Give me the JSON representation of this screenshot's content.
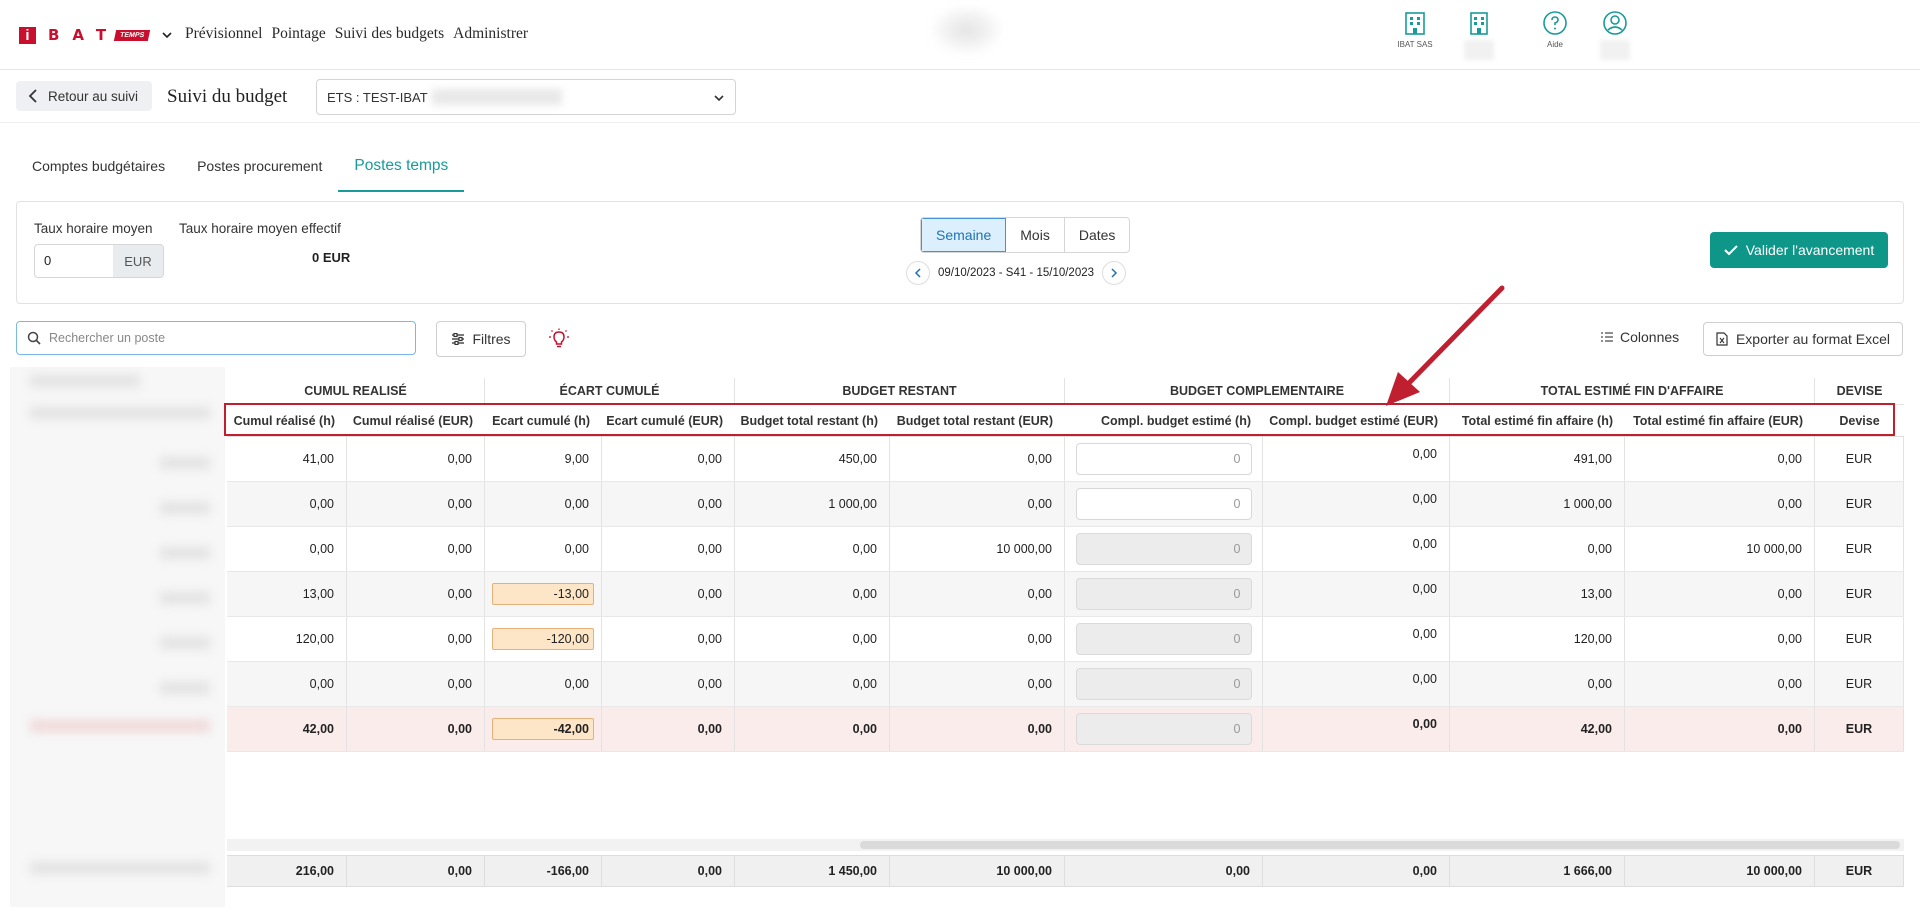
{
  "brand": {
    "letters": "BAT",
    "i": "i",
    "badge": "TEMPS"
  },
  "nav": [
    "Prévisionnel",
    "Pointage",
    "Suivi des budgets",
    "Administrer"
  ],
  "top_icons": [
    {
      "name": "building-icon",
      "label": "IBAT SAS"
    },
    {
      "name": "building-2-icon",
      "label": ""
    },
    {
      "name": "help-icon",
      "label": "Aide"
    },
    {
      "name": "user-icon",
      "label": ""
    }
  ],
  "subheader": {
    "back": "Retour au suivi",
    "title": "Suivi du budget",
    "ets": "ETS : TEST-IBAT"
  },
  "tabs": [
    "Comptes budgétaires",
    "Postes procurement",
    "Postes temps"
  ],
  "card": {
    "rate_label": "Taux horaire moyen",
    "rate_value": "0",
    "rate_unit": "EUR",
    "eff_label": "Taux horaire moyen effectif",
    "eff_value": "0 EUR",
    "periods": [
      "Semaine",
      "Mois",
      "Dates"
    ],
    "date_range": "09/10/2023 - S41 - 15/10/2023",
    "validate": "Valider l'avancement"
  },
  "toolbar": {
    "search_placeholder": "Rechercher un poste",
    "filters": "Filtres",
    "columns": "Colonnes",
    "export": "Exporter au format Excel"
  },
  "table": {
    "groups": [
      "CUMUL REALISÉ",
      "ÉCART CUMULÉ",
      "BUDGET RESTANT",
      "BUDGET COMPLEMENTAIRE",
      "TOTAL ESTIMÉ FIN D'AFFAIRE",
      "DEVISE"
    ],
    "headers": [
      "Cumul réalisé (h)",
      "Cumul réalisé (EUR)",
      "Ecart cumulé (h)",
      "Ecart cumulé (EUR)",
      "Budget total restant (h)",
      "Budget total restant (EUR)",
      "Compl. budget estimé (h)",
      "Compl. budget estimé (EUR)",
      "Total estimé fin affaire (h)",
      "Total estimé fin affaire (EUR)",
      "Devise"
    ],
    "rows": [
      {
        "c0": "41,00",
        "c1": "0,00",
        "c2": "9,00",
        "c3": "0,00",
        "c4": "450,00",
        "c5": "0,00",
        "c6": "0",
        "c7": "0,00",
        "c8": "491,00",
        "c9": "0,00",
        "c10": "EUR"
      },
      {
        "c0": "0,00",
        "c1": "0,00",
        "c2": "0,00",
        "c3": "0,00",
        "c4": "1 000,00",
        "c5": "0,00",
        "c6": "0",
        "c7": "0,00",
        "c8": "1 000,00",
        "c9": "0,00",
        "c10": "EUR"
      },
      {
        "c0": "0,00",
        "c1": "0,00",
        "c2": "0,00",
        "c3": "0,00",
        "c4": "0,00",
        "c5": "10 000,00",
        "c6": "0",
        "c7": "0,00",
        "c8": "0,00",
        "c9": "10 000,00",
        "c10": "EUR"
      },
      {
        "c0": "13,00",
        "c1": "0,00",
        "c2": "-13,00",
        "c3": "0,00",
        "c4": "0,00",
        "c5": "0,00",
        "c6": "0",
        "c7": "0,00",
        "c8": "13,00",
        "c9": "0,00",
        "c10": "EUR"
      },
      {
        "c0": "120,00",
        "c1": "0,00",
        "c2": "-120,00",
        "c3": "0,00",
        "c4": "0,00",
        "c5": "0,00",
        "c6": "0",
        "c7": "0,00",
        "c8": "120,00",
        "c9": "0,00",
        "c10": "EUR"
      },
      {
        "c0": "0,00",
        "c1": "0,00",
        "c2": "0,00",
        "c3": "0,00",
        "c4": "0,00",
        "c5": "0,00",
        "c6": "0",
        "c7": "0,00",
        "c8": "0,00",
        "c9": "0,00",
        "c10": "EUR"
      },
      {
        "c0": "42,00",
        "c1": "0,00",
        "c2": "-42,00",
        "c3": "0,00",
        "c4": "0,00",
        "c5": "0,00",
        "c6": "0",
        "c7": "0,00",
        "c8": "42,00",
        "c9": "0,00",
        "c10": "EUR"
      }
    ],
    "totals": [
      "216,00",
      "0,00",
      "-166,00",
      "0,00",
      "1 450,00",
      "10 000,00",
      "0,00",
      "0,00",
      "1 666,00",
      "10 000,00",
      "EUR"
    ]
  },
  "colors": {
    "brand": "#c8102e",
    "accent": "#0e9688",
    "tab_active": "#1a9a9a",
    "annotation": "#c01f2f"
  }
}
